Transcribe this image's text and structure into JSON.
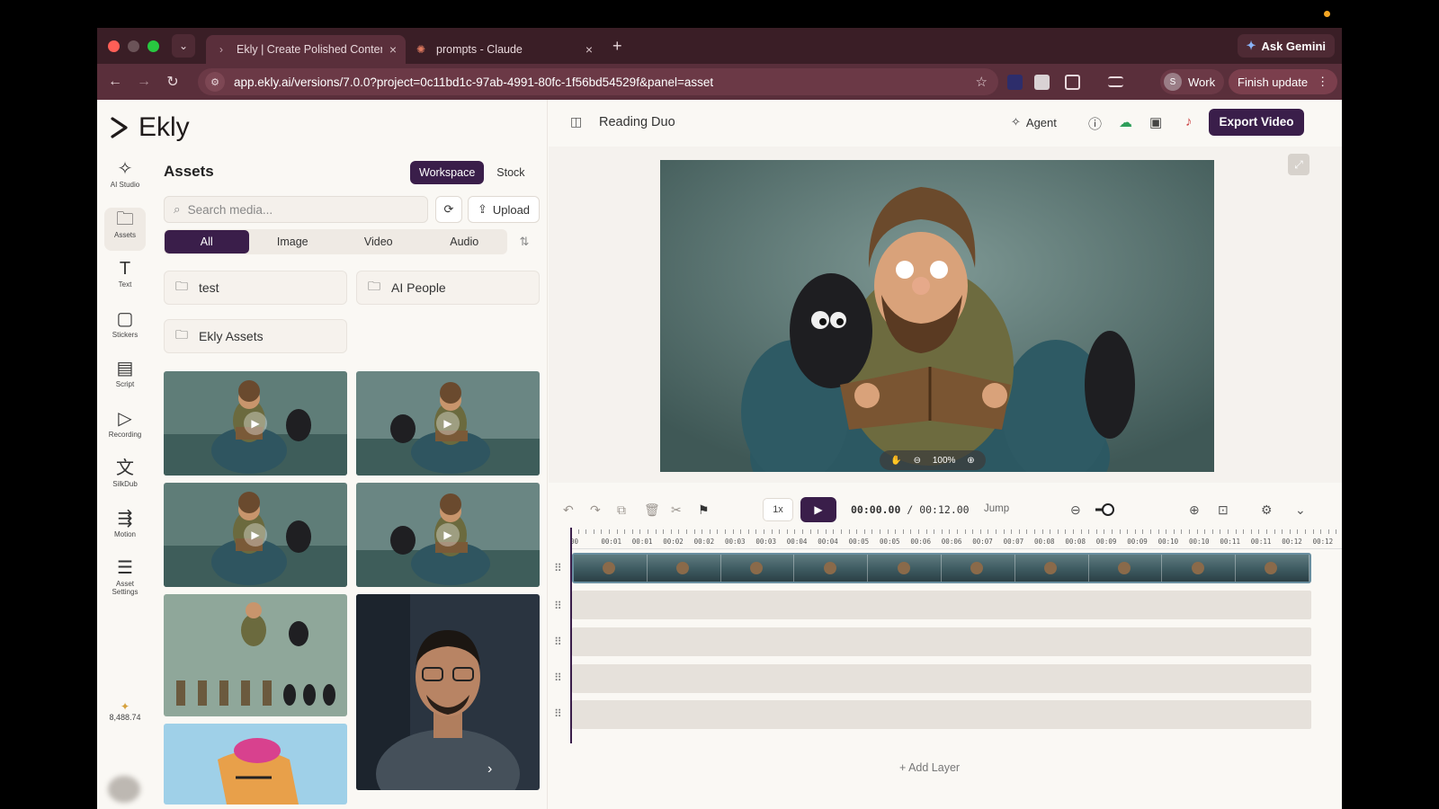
{
  "browser": {
    "tabs": [
      {
        "title": "Ekly | Create Polished Conten",
        "active": true
      },
      {
        "title": "prompts - Claude",
        "active": false
      }
    ],
    "new_tab": "+",
    "gemini": "Ask Gemini",
    "url": "app.ekly.ai/versions/7.0.0?project=0c11bd1c-97ab-4991-80fc-1f56bd54529f&panel=asset",
    "profile_initial": "S",
    "profile": "Work",
    "finish_update": "Finish update"
  },
  "app": {
    "logo": "Ekly",
    "rail": [
      {
        "icon": "ai-studio-icon",
        "label": "AI Studio",
        "glyph": "✧"
      },
      {
        "icon": "assets-icon",
        "label": "Assets",
        "glyph": "🗀",
        "selected": true
      },
      {
        "icon": "text-icon",
        "label": "Text",
        "glyph": "T"
      },
      {
        "icon": "stickers-icon",
        "label": "Stickers",
        "glyph": "▢"
      },
      {
        "icon": "script-icon",
        "label": "Script",
        "glyph": "▤"
      },
      {
        "icon": "recording-icon",
        "label": "Recording",
        "glyph": "▷"
      },
      {
        "icon": "silkdub-icon",
        "label": "SilkDub",
        "glyph": "文"
      },
      {
        "icon": "motion-icon",
        "label": "Motion",
        "glyph": "⇶"
      },
      {
        "icon": "asset-settings-icon",
        "label": "Asset Settings",
        "glyph": "☰"
      }
    ],
    "credits": "8,488.74",
    "assets": {
      "title": "Assets",
      "source_tabs": [
        "Workspace",
        "Stock"
      ],
      "search_placeholder": "Search media...",
      "upload": "Upload",
      "filters": [
        "All",
        "Image",
        "Video",
        "Audio"
      ],
      "folders": [
        "test",
        "AI People",
        "Ekly Assets"
      ]
    },
    "project_title": "Reading Duo",
    "agent": "Agent",
    "export": "Export Video",
    "preview_zoom": "100%",
    "speed": "1x",
    "current_time": "00:00.00",
    "separator": "/",
    "total_time": "00:12.00",
    "jump": "Jump",
    "ruler_labels": [
      "00",
      "00:01",
      "00:01",
      "00:02",
      "00:02",
      "00:03",
      "00:03",
      "00:04",
      "00:04",
      "00:05",
      "00:05",
      "00:06",
      "00:06",
      "00:07",
      "00:07",
      "00:08",
      "00:08",
      "00:09",
      "00:09",
      "00:10",
      "00:10",
      "00:11",
      "00:11",
      "00:12",
      "00:12"
    ],
    "add_layer": "+ Add Layer"
  },
  "colors": {
    "accent": "#3a1e4a",
    "browser_chrome": "#5a2f3b"
  }
}
